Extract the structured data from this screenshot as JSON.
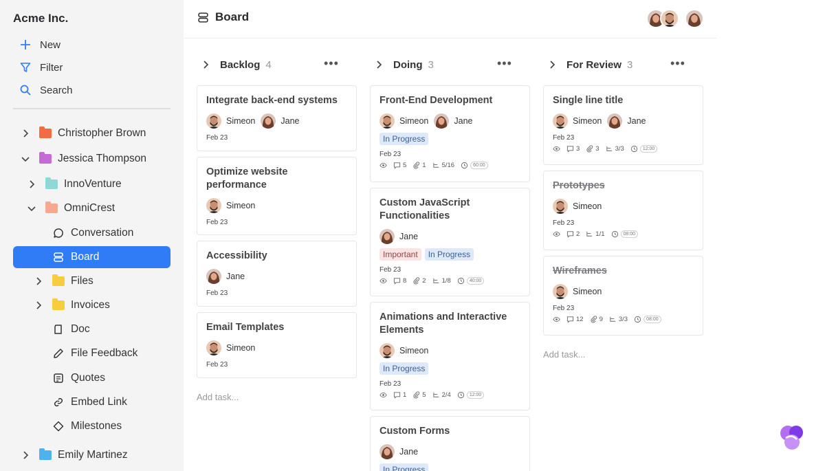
{
  "sidebar": {
    "org_name": "Acme Inc.",
    "actions": [
      {
        "label": "New",
        "icon": "plus-icon"
      },
      {
        "label": "Filter",
        "icon": "filter-icon"
      },
      {
        "label": "Search",
        "icon": "search-icon"
      }
    ],
    "tree": [
      {
        "label": "Christopher Brown",
        "icon": "folder-icon",
        "color": "#f26b43",
        "chevron": "right"
      },
      {
        "label": "Jessica Thompson",
        "icon": "folder-icon",
        "color": "#c56bd6",
        "chevron": "down"
      },
      {
        "label": "InnoVenture",
        "icon": "folder-icon",
        "color": "#8fd8d8",
        "chevron": "right"
      },
      {
        "label": "OmniCrest",
        "icon": "folder-icon",
        "color": "#f7a98f",
        "chevron": "down"
      },
      {
        "label": "Conversation",
        "icon": "chat-bubble-icon"
      },
      {
        "label": "Board",
        "icon": "board-icon",
        "active": true
      },
      {
        "label": "Files",
        "icon": "folder-icon",
        "color": "#f8cd3d",
        "chevron": "right"
      },
      {
        "label": "Invoices",
        "icon": "folder-icon",
        "color": "#f8cd3d",
        "chevron": "right"
      },
      {
        "label": "Doc",
        "icon": "document-icon"
      },
      {
        "label": "File Feedback",
        "icon": "pencil-icon"
      },
      {
        "label": "Quotes",
        "icon": "quotes-icon"
      },
      {
        "label": "Embed Link",
        "icon": "link-icon"
      },
      {
        "label": "Milestones",
        "icon": "diamond-icon"
      },
      {
        "label": "Emily Martinez",
        "icon": "folder-icon",
        "color": "#4fb2ec",
        "chevron": "right"
      }
    ]
  },
  "header": {
    "title": "Board"
  },
  "accent": "#2f7cf6",
  "columns": [
    {
      "name": "Backlog",
      "count": "4"
    },
    {
      "name": "Doing",
      "count": "3"
    },
    {
      "name": "For Review",
      "count": "3"
    }
  ],
  "people": {
    "simeon": "Simeon",
    "jane": "Jane"
  },
  "cards": {
    "c1": {
      "title": "Integrate back-end systems",
      "date": "Feb 23"
    },
    "c2": {
      "title": "Optimize website performance",
      "date": "Feb 23"
    },
    "c3": {
      "title": "Accessibility",
      "date": "Feb 23"
    },
    "c4": {
      "title": "Email Templates",
      "date": "Feb 23"
    },
    "d1": {
      "title": "Front-End Development",
      "tag": "In Progress",
      "date": "Feb 23",
      "comments": "5",
      "attachments": "1",
      "subtasks": "5/16",
      "time": "60:00"
    },
    "d2": {
      "title": "Custom JavaScript Functionalities",
      "tag1": "Important",
      "tag2": "In Progress",
      "date": "Feb 23",
      "comments": "8",
      "attachments": "2",
      "subtasks": "1/8",
      "time": "40:00"
    },
    "d3": {
      "title": "Animations and Interactive Elements",
      "tag": "In Progress",
      "date": "Feb 23",
      "comments": "1",
      "attachments": "5",
      "subtasks": "2/4",
      "time": "12:00"
    },
    "d4": {
      "title": "Custom Forms",
      "tag": "In Progress"
    },
    "r1": {
      "title": "Single line title",
      "date": "Feb 23",
      "comments": "3",
      "attachments": "3",
      "subtasks": "3/3",
      "time": "12:00"
    },
    "r2": {
      "title": "Prototypes",
      "date": "Feb 23",
      "comments": "2",
      "subtasks": "1/1",
      "time": "08:00"
    },
    "r3": {
      "title": "Wireframes",
      "date": "Feb 23",
      "comments": "12",
      "attachments": "9",
      "subtasks": "3/3",
      "time": "08:00"
    }
  },
  "add_task": "Add task..."
}
